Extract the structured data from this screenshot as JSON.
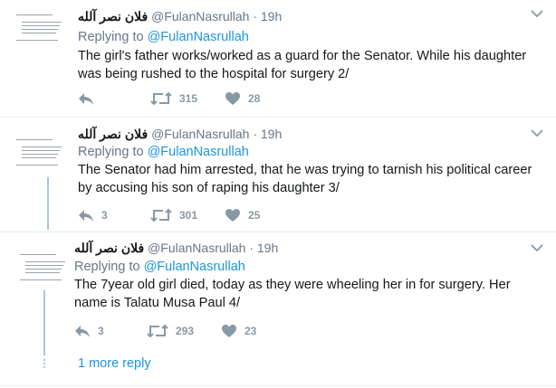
{
  "tweets": [
    {
      "name": "فلان نصر آلله",
      "handle": "@FulanNasrullah",
      "dot": "·",
      "time": "19h",
      "replying_prefix": "Replying to ",
      "replying_to": "@FulanNasrullah",
      "line1": "The girl's father works/worked as a guard for the Senator. While his daughter",
      "line2": "was being rushed to the hospital for surgery 2/",
      "replies": "",
      "retweets": "315",
      "likes": "28"
    },
    {
      "name": "فلان نصر آلله",
      "handle": "@FulanNasrullah",
      "dot": "·",
      "time": "19h",
      "replying_prefix": "Replying to ",
      "replying_to": "@FulanNasrullah",
      "line1": "The Senator had him arrested, that he was trying to tarnish his political career",
      "line2": "by accusing his son of raping his daughter 3/",
      "replies": "3",
      "retweets": "301",
      "likes": "25"
    },
    {
      "name": "فلان نصر آلله",
      "handle": "@FulanNasrullah",
      "dot": "·",
      "time": "19h",
      "replying_prefix": "Replying to ",
      "replying_to": "@FulanNasrullah",
      "line1": "The 7year old girl died, today as they were wheeling her in for surgery. Her",
      "line2": "name is Talatu Musa Paul 4/",
      "replies": "3",
      "retweets": "293",
      "likes": "23"
    }
  ],
  "more_replies": "1 more reply",
  "colors": {
    "link": "#1b95e0",
    "muted": "#657786",
    "icon": "#8899a6",
    "thread": "#a9c4e0"
  },
  "icons": [
    "reply-icon",
    "retweet-icon",
    "like-icon",
    "chevron-down-icon"
  ]
}
